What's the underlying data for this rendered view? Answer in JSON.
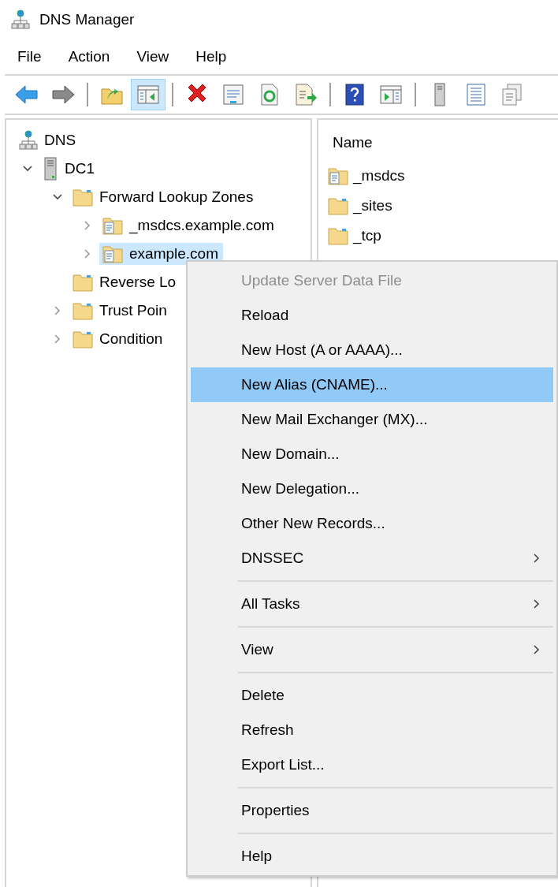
{
  "window": {
    "title": "DNS Manager"
  },
  "menu_bar": [
    "File",
    "Action",
    "View",
    "Help"
  ],
  "toolbar": [
    {
      "kind": "back",
      "pressed": false
    },
    {
      "kind": "forward",
      "pressed": false
    },
    {
      "kind": "separator"
    },
    {
      "kind": "up",
      "pressed": false
    },
    {
      "kind": "tree",
      "pressed": true
    },
    {
      "kind": "separator"
    },
    {
      "kind": "delete",
      "pressed": false
    },
    {
      "kind": "properties",
      "pressed": false
    },
    {
      "kind": "refresh",
      "pressed": false
    },
    {
      "kind": "export",
      "pressed": false
    },
    {
      "kind": "separator"
    },
    {
      "kind": "help",
      "pressed": false
    },
    {
      "kind": "action_pane",
      "pressed": false
    },
    {
      "kind": "separator"
    },
    {
      "kind": "server",
      "pressed": false
    },
    {
      "kind": "list",
      "pressed": false
    },
    {
      "kind": "copy",
      "pressed": false
    }
  ],
  "tree": {
    "label": "DNS",
    "kind": "dns",
    "children": [
      {
        "label": "DC1",
        "kind": "server",
        "expanded": true,
        "selected": false,
        "children": [
          {
            "label": "Forward Lookup Zones",
            "kind": "folder",
            "expanded": true,
            "selected": false,
            "children": [
              {
                "label": "_msdcs.example.com",
                "kind": "zone",
                "expanded": false,
                "selected": false
              },
              {
                "label": "example.com",
                "kind": "zone",
                "expanded": false,
                "selected": true
              }
            ]
          },
          {
            "label": "Reverse Lo",
            "kind": "folder",
            "selected": false
          },
          {
            "label": "Trust Poin",
            "kind": "folder",
            "expanded": false,
            "selected": false
          },
          {
            "label": "Condition",
            "kind": "folder",
            "expanded": false,
            "selected": false
          }
        ]
      }
    ]
  },
  "list": {
    "columns": [
      "Name"
    ],
    "rows": [
      {
        "name": "_msdcs",
        "kind": "zone"
      },
      {
        "name": "_sites",
        "kind": "folder"
      },
      {
        "name": "_tcp",
        "kind": "folder"
      }
    ]
  },
  "context_menu": [
    {
      "kind": "item",
      "label": "Update Server Data File",
      "disabled": true,
      "selected": false,
      "submenu": false
    },
    {
      "kind": "item",
      "label": "Reload",
      "disabled": false,
      "selected": false,
      "submenu": false
    },
    {
      "kind": "item",
      "label": "New Host (A or AAAA)...",
      "disabled": false,
      "selected": false,
      "submenu": false
    },
    {
      "kind": "item",
      "label": "New Alias (CNAME)...",
      "disabled": false,
      "selected": true,
      "submenu": false
    },
    {
      "kind": "item",
      "label": "New Mail Exchanger (MX)...",
      "disabled": false,
      "selected": false,
      "submenu": false
    },
    {
      "kind": "item",
      "label": "New Domain...",
      "disabled": false,
      "selected": false,
      "submenu": false
    },
    {
      "kind": "item",
      "label": "New Delegation...",
      "disabled": false,
      "selected": false,
      "submenu": false
    },
    {
      "kind": "item",
      "label": "Other New Records...",
      "disabled": false,
      "selected": false,
      "submenu": false
    },
    {
      "kind": "item",
      "label": "DNSSEC",
      "disabled": false,
      "selected": false,
      "submenu": true
    },
    {
      "kind": "separator"
    },
    {
      "kind": "item",
      "label": "All Tasks",
      "disabled": false,
      "selected": false,
      "submenu": true
    },
    {
      "kind": "separator"
    },
    {
      "kind": "item",
      "label": "View",
      "disabled": false,
      "selected": false,
      "submenu": true
    },
    {
      "kind": "separator"
    },
    {
      "kind": "item",
      "label": "Delete",
      "disabled": false,
      "selected": false,
      "submenu": false
    },
    {
      "kind": "item",
      "label": "Refresh",
      "disabled": false,
      "selected": false,
      "submenu": false
    },
    {
      "kind": "item",
      "label": "Export List...",
      "disabled": false,
      "selected": false,
      "submenu": false
    },
    {
      "kind": "separator"
    },
    {
      "kind": "item",
      "label": "Properties",
      "disabled": false,
      "selected": false,
      "submenu": false
    },
    {
      "kind": "separator"
    },
    {
      "kind": "item",
      "label": "Help",
      "disabled": false,
      "selected": false,
      "submenu": false
    }
  ]
}
